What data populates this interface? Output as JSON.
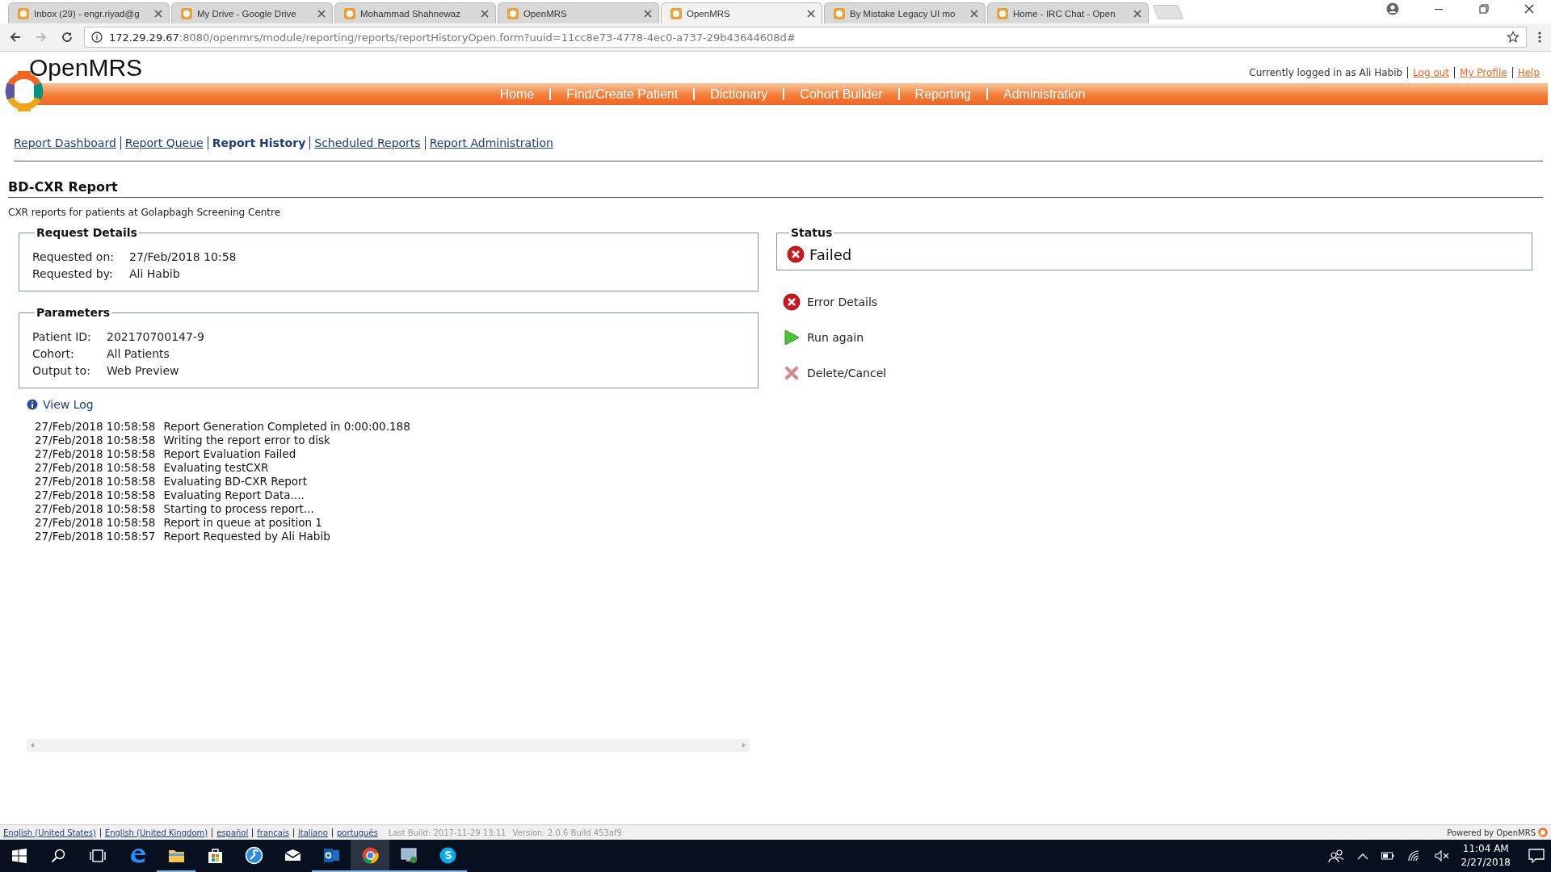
{
  "browser": {
    "tabs": [
      {
        "title": "Inbox (29) - engr.riyad@g",
        "selected": false
      },
      {
        "title": "My Drive - Google Drive",
        "selected": false
      },
      {
        "title": "Mohammad Shahnewaz",
        "selected": false
      },
      {
        "title": "OpenMRS",
        "selected": false
      },
      {
        "title": "OpenMRS",
        "selected": true
      },
      {
        "title": "By Mistake Legacy UI mo",
        "selected": false
      },
      {
        "title": "Home - IRC Chat - Open",
        "selected": false
      }
    ],
    "address": {
      "host": "172.29.29.67",
      "path": ":8080/openmrs/module/reporting/reports/reportHistoryOpen.form?uuid=11cc8e73-4778-4ec0-a737-29b43644608d#"
    }
  },
  "header": {
    "logo_text": "OpenMRS",
    "user_text": "Currently logged in as Ali Habib",
    "user_links": [
      "Log out",
      "My Profile",
      "Help"
    ],
    "nav": [
      "Home",
      "Find/Create Patient",
      "Dictionary",
      "Cohort Builder",
      "Reporting",
      "Administration"
    ]
  },
  "subnav": [
    {
      "label": "Report Dashboard",
      "selected": false
    },
    {
      "label": "Report Queue",
      "selected": false
    },
    {
      "label": "Report History",
      "selected": true
    },
    {
      "label": "Scheduled Reports",
      "selected": false
    },
    {
      "label": "Report Administration",
      "selected": false
    }
  ],
  "report": {
    "title": "BD-CXR Report",
    "description": "CXR reports for patients at Golapbagh Screening Centre"
  },
  "request_details": {
    "legend": "Request Details",
    "rows": [
      {
        "label": "Requested on:",
        "value": "27/Feb/2018 10:58"
      },
      {
        "label": "Requested by:",
        "value": "Ali Habib"
      }
    ]
  },
  "parameters": {
    "legend": "Parameters",
    "rows": [
      {
        "label": "Patient ID:",
        "value": "202170700147-9"
      },
      {
        "label": "Cohort:",
        "value": "All Patients"
      },
      {
        "label": "Output to:",
        "value": "Web Preview"
      }
    ]
  },
  "view_log": "View Log",
  "log": [
    {
      "time": "27/Feb/2018 10:58:58",
      "message": "Report Generation Completed in 0:00:00.188"
    },
    {
      "time": "27/Feb/2018 10:58:58",
      "message": "Writing the report error to disk"
    },
    {
      "time": "27/Feb/2018 10:58:58",
      "message": "Report Evaluation Failed"
    },
    {
      "time": "27/Feb/2018 10:58:58",
      "message": "Evaluating testCXR"
    },
    {
      "time": "27/Feb/2018 10:58:58",
      "message": "Evaluating BD-CXR Report"
    },
    {
      "time": "27/Feb/2018 10:58:58",
      "message": "Evaluating Report Data...."
    },
    {
      "time": "27/Feb/2018 10:58:58",
      "message": "Starting to process report..."
    },
    {
      "time": "27/Feb/2018 10:58:58",
      "message": "Report in queue at position 1"
    },
    {
      "time": "27/Feb/2018 10:58:57",
      "message": "Report Requested by Ali Habib"
    }
  ],
  "status": {
    "legend": "Status",
    "value": "Failed"
  },
  "actions": [
    {
      "kind": "error",
      "label": "Error Details"
    },
    {
      "kind": "run",
      "label": "Run again"
    },
    {
      "kind": "delete",
      "label": "Delete/Cancel"
    }
  ],
  "footer": {
    "locales": [
      "English (United States)",
      "English (United Kingdom)",
      "español",
      "français",
      "italiano",
      "português"
    ],
    "build": "Last Build: 2017-11-29 13:11",
    "version": "Version: 2.0.6 Build 453af9",
    "powered": "Powered by OpenMRS"
  },
  "taskbar": {
    "apps": [
      {
        "running": false,
        "selected": false
      },
      {
        "running": true,
        "selected": false
      },
      {
        "running": false,
        "selected": false
      },
      {
        "running": false,
        "selected": false
      },
      {
        "running": false,
        "selected": false
      },
      {
        "running": true,
        "selected": false
      },
      {
        "running": true,
        "selected": true
      },
      {
        "running": true,
        "selected": false
      },
      {
        "running": true,
        "selected": false
      }
    ],
    "time": "11:04 AM",
    "date": "2/27/2018"
  }
}
